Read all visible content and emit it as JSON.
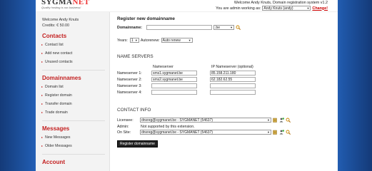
{
  "header": {
    "logo_text_a": "SYGMA",
    "logo_text_b": "NET",
    "tagline": "Quality hosting is our business!",
    "welcome": "Welcome Andy Knuts, Domain registration system v1.2",
    "admin_prefix": "You are admin working as:",
    "admin_selected": "Andy Knuts (andy)",
    "change_label": "Change!"
  },
  "sidebar": {
    "welcome": "Welcome Andy Knuts",
    "credits": "Credits: € 50.00",
    "sections": [
      {
        "title": "Contacts",
        "items": [
          "Contact list",
          "Add new contact",
          "Unused contacts"
        ]
      },
      {
        "title": "Domainnames",
        "items": [
          "Domain list",
          "Register domain",
          "Transfer domain",
          "Trade domain"
        ]
      },
      {
        "title": "Messages",
        "items": [
          "New Messages",
          "Older Messages"
        ]
      },
      {
        "title": "Account",
        "items": []
      }
    ]
  },
  "main": {
    "title": "Register new domainname",
    "domain_label": "Domainname:",
    "domain_value": "",
    "tld_value": ".be",
    "years_label": "Years:",
    "years_value": "1",
    "autorenew_label": "Autorenew:",
    "autorenew_value": "Auto renew",
    "ns_heading": "NAME SERVERS",
    "ns_col_name": "Nameserver",
    "ns_col_ip": "IP Nameserver (optional)",
    "nameservers": [
      {
        "label": "Nameserver 1:",
        "name": "sms1.sygmanet.be",
        "ip": "85.158.211.180"
      },
      {
        "label": "Nameserver 2:",
        "name": "sms2.sygmanet.be",
        "ip": "62.182.62.55"
      },
      {
        "label": "Nameserver 3:",
        "name": "",
        "ip": ""
      },
      {
        "label": "Nameserver 4:",
        "name": "",
        "ip": ""
      }
    ],
    "contact_heading": "CONTACT INFO",
    "licensee_label": "Licensee:",
    "licensee_value": "dnsreg@sygmanet.be - SYGMANET (54637)",
    "admin_label": "Admin:",
    "admin_value": "Not supported by this extension.",
    "onsite_label": "On Site:",
    "onsite_value": "dnsreg@sygmanet.be - SYGMANET (54637)",
    "submit_label": "Register domainname"
  }
}
